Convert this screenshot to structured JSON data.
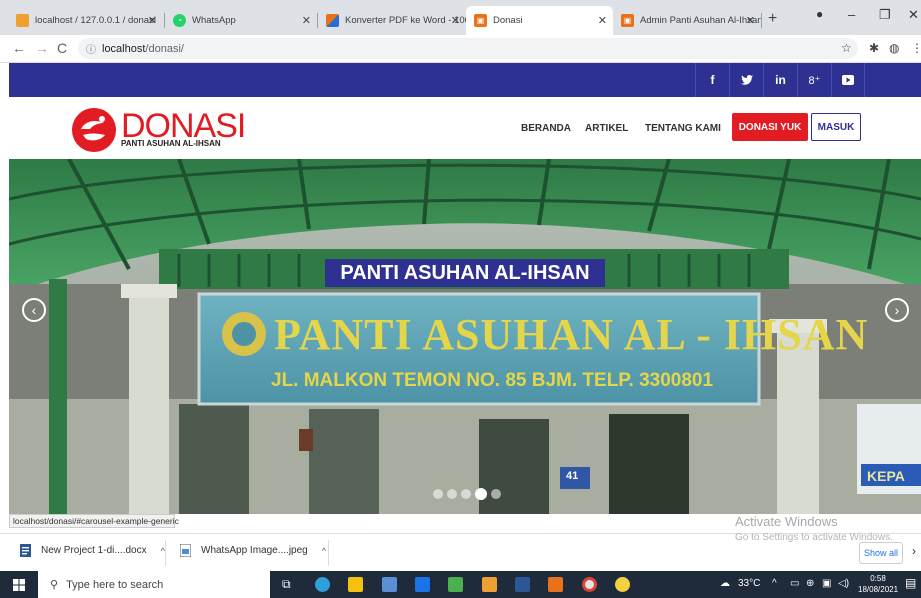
{
  "browser": {
    "tabs": [
      {
        "title": "localhost / 127.0.0.1 / donasi",
        "icon": "phpmyadmin-icon",
        "color": "#f0a030"
      },
      {
        "title": "WhatsApp",
        "icon": "whatsapp-icon",
        "color": "#25d366"
      },
      {
        "title": "Konverter PDF ke Word - 100",
        "icon": "converter-icon",
        "color": "#e8711a"
      },
      {
        "title": "Donasi",
        "icon": "donasi-favicon",
        "color": "#e8711a"
      },
      {
        "title": "Admin Panti Asuhan Al-Ihsan",
        "icon": "admin-favicon",
        "color": "#e8711a"
      }
    ],
    "new_tab": "+",
    "url_host": "localhost",
    "url_path": "/donasi/"
  },
  "site": {
    "brand": "DONASI",
    "brand_sub": "PANTI ASUHAN AL-IHSAN",
    "social": [
      "f",
      "y",
      "in",
      "g+",
      "yt"
    ],
    "menu": [
      "BERANDA",
      "ARTIKEL",
      "TENTANG KAMI"
    ],
    "donate_btn": "DONASI YUK",
    "login_btn": "MASUK",
    "brand_color": "#e31b23",
    "accent_color": "#2e3192"
  },
  "carousel": {
    "caption": "PANTI ASUHAN AL-IHSAN",
    "sign_title": "PANTI ASUHAN AL - IHSAN",
    "sign_address": "JL. MALKON TEMON NO. 85 BJM. TELP. 3300801",
    "side_banner": "KEPA",
    "house_number": "41",
    "slide_count": 5,
    "active_slide": 4
  },
  "statusbar": {
    "url": "localhost/donasi/#carousel-example-generic"
  },
  "watermark": {
    "line1": "Activate Windows",
    "line2": "Go to Settings to activate Windows."
  },
  "downloads": {
    "items": [
      "New Project 1-di....docx",
      "WhatsApp Image....jpeg"
    ],
    "show_all": "Show all"
  },
  "taskbar": {
    "search_placeholder": "Type here to search",
    "weather": "33°C",
    "time": "0:58",
    "date": "18/08/2021"
  }
}
